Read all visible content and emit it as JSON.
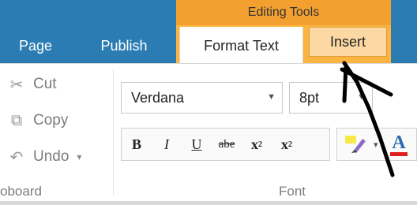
{
  "contextual_group": {
    "label": "Editing Tools"
  },
  "tabs": {
    "page": "Page",
    "publish": "Publish",
    "format_text": "Format Text",
    "insert": "Insert"
  },
  "clipboard": {
    "cut": "Cut",
    "copy": "Copy",
    "undo": "Undo",
    "group_label": "oboard"
  },
  "font": {
    "family": "Verdana",
    "size": "8pt",
    "group_label": "Font",
    "buttons": {
      "bold": "B",
      "italic": "I",
      "underline": "U",
      "strikethrough": "abe",
      "subscript": "x",
      "superscript": "x",
      "font_color": "A"
    }
  },
  "colors": {
    "ribbon_blue": "#2b7cb3",
    "contextual_orange": "#f4a030",
    "insert_highlight": "#fcd8a3",
    "font_color_red": "#e02020"
  },
  "icons": [
    "scissors-icon",
    "copy-icon",
    "undo-icon",
    "highlighter-icon",
    "dropdown-icon"
  ]
}
